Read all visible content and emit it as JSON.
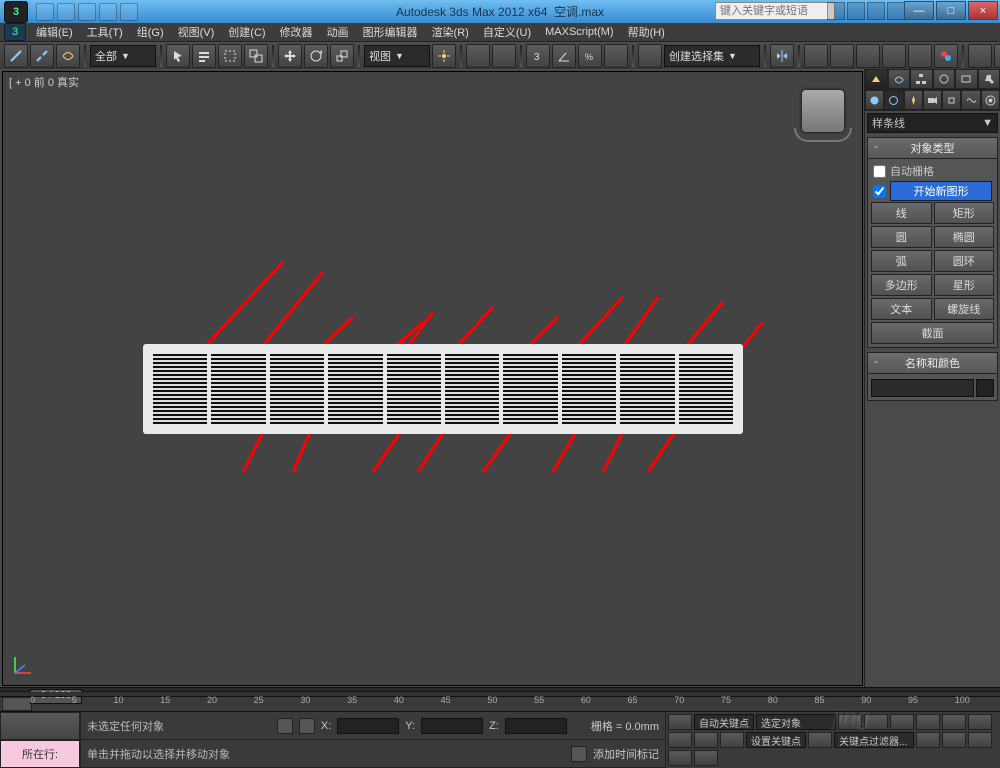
{
  "title": {
    "app": "Autodesk 3ds Max  2012 x64",
    "doc": "空调.max"
  },
  "search_placeholder": "键入关键字或短语",
  "winbtns": {
    "min": "—",
    "max": "□",
    "close": "×"
  },
  "menu": [
    "编辑(E)",
    "工具(T)",
    "组(G)",
    "视图(V)",
    "创建(C)",
    "修改器",
    "动画",
    "图形编辑器",
    "渲染(R)",
    "自定义(U)",
    "MAXScript(M)",
    "帮助(H)"
  ],
  "toolbar": {
    "filter": "全部",
    "view_label": "视图",
    "named_sel": "创建选择集"
  },
  "viewport": {
    "label": "[ + 0 前 0 真实"
  },
  "cmdpanel": {
    "dropdown": "样条线",
    "rollout_objtype": "对象类型",
    "auto_grid": "自动栅格",
    "start_new": "开始新图形",
    "buttons": [
      [
        "线",
        "矩形"
      ],
      [
        "圆",
        "椭圆"
      ],
      [
        "弧",
        "圆环"
      ],
      [
        "多边形",
        "星形"
      ],
      [
        "文本",
        "螺旋线"
      ],
      [
        "截面",
        ""
      ]
    ],
    "rollout_name": "名称和颜色"
  },
  "timeline": {
    "slider": "0 / 100",
    "ticks": [
      "0",
      "5",
      "10",
      "15",
      "20",
      "25",
      "30",
      "35",
      "40",
      "45",
      "50",
      "55",
      "60",
      "65",
      "70",
      "75",
      "80",
      "85",
      "90",
      "95",
      "100"
    ]
  },
  "status": {
    "row_label": "所在行:",
    "prompt1": "未选定任何对象",
    "prompt2": "单击并拖动以选择并移动对象",
    "add_time": "添加时间标记",
    "coord_x": "X:",
    "coord_y": "Y:",
    "coord_z": "Z:",
    "grid": "栅格 = 0.0mm",
    "autokey": "自动关键点",
    "selobj": "选定对象",
    "setkey": "设置关键点",
    "keyfilter": "关键点过滤器..."
  },
  "watermark": "jing"
}
